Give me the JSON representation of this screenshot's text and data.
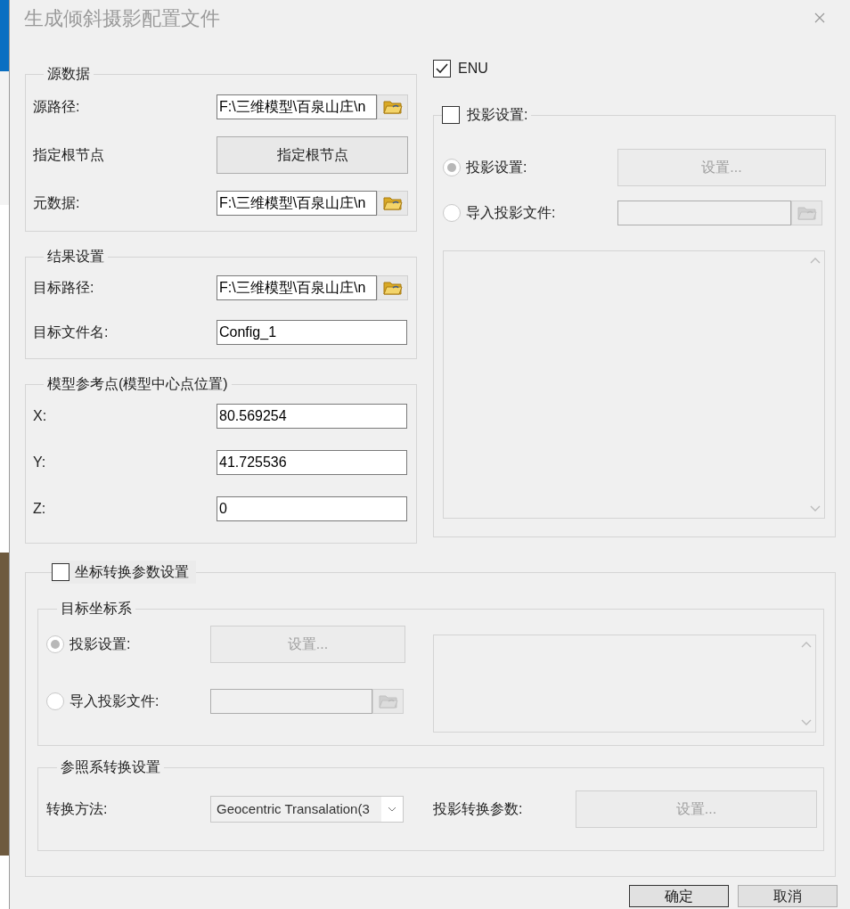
{
  "window": {
    "title": "生成倾斜摄影配置文件"
  },
  "source_data": {
    "legend": "源数据",
    "rows": [
      {
        "kind": "path",
        "label": "源路径:",
        "value": "F:\\三维模型\\百泉山庄\\n"
      },
      {
        "kind": "button",
        "label": "指定根节点",
        "button": "指定根节点"
      },
      {
        "kind": "path",
        "label": "元数据:",
        "value": "F:\\三维模型\\百泉山庄\\n"
      }
    ]
  },
  "result_settings": {
    "legend": "结果设置",
    "rows": [
      {
        "kind": "path",
        "label": "目标路径:",
        "value": "F:\\三维模型\\百泉山庄\\n"
      },
      {
        "kind": "text",
        "label": "目标文件名:",
        "value": "Config_1"
      }
    ]
  },
  "reference_point": {
    "legend": "模型参考点(模型中心点位置)",
    "rows": [
      {
        "kind": "text",
        "label": "X:",
        "value": "80.569254"
      },
      {
        "kind": "text",
        "label": "Y:",
        "value": "41.725536"
      },
      {
        "kind": "text",
        "label": "Z:",
        "value": "0"
      }
    ]
  },
  "enu": {
    "label": "ENU",
    "checked": true
  },
  "projection": {
    "label": "投影设置:",
    "checked": false,
    "options": [
      {
        "kind": "button",
        "label": "投影设置:",
        "selected": true,
        "button": "设置..."
      },
      {
        "kind": "file",
        "label": "导入投影文件:",
        "selected": false
      }
    ]
  },
  "coordinate_transform": {
    "label": "坐标转换参数设置",
    "checked": false,
    "target": {
      "legend": "目标坐标系",
      "options": [
        {
          "kind": "button",
          "label": "投影设置:",
          "selected": true,
          "button": "设置..."
        },
        {
          "kind": "file",
          "label": "导入投影文件:",
          "selected": false
        }
      ]
    },
    "reference": {
      "legend": "参照系转换设置",
      "method_label": "转换方法:",
      "method_value": "Geocentric Transalation(3",
      "param_label": "投影转换参数:",
      "param_button": "设置..."
    }
  },
  "buttons": [
    {
      "label": "确定",
      "kind": "primary"
    },
    {
      "label": "取消",
      "kind": "normal"
    }
  ]
}
